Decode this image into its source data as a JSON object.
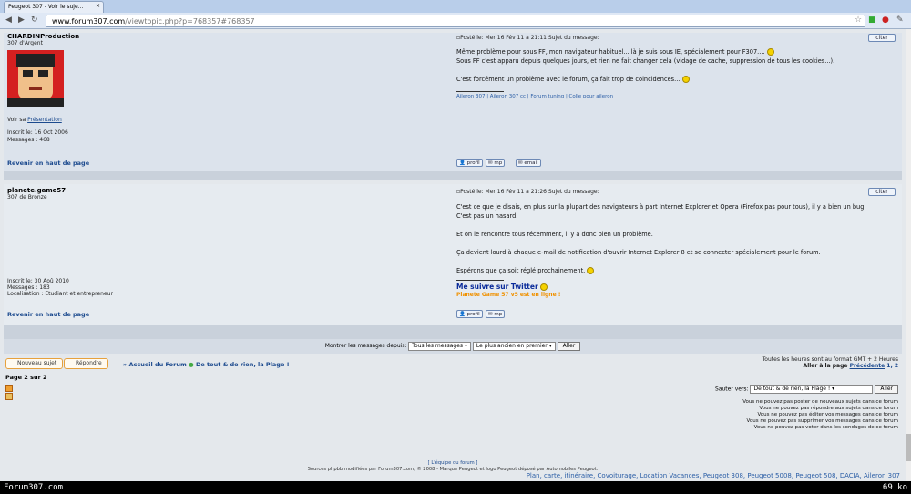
{
  "browser": {
    "tab_title": "Peugeot 307 - Voir le suje...",
    "url_domain": "www.forum307.com",
    "url_path": "/viewtopic.php?p=768357#768357"
  },
  "post1": {
    "username": "CHARDINProduction",
    "rank": "307 d'Argent",
    "see_label": "Voir sa",
    "presentation_link": "Présentation",
    "joined": "Inscrit le: 16 Oct 2006",
    "messages": "Messages : 468",
    "meta": "Posté le: Mer 16 Fév 11 à 21:11     Sujet du message:",
    "quote": "citer",
    "body": [
      "Même problème pour sous FF, mon navigateur habituel... là je suis sous IE, spécialement pour F307....",
      "Sous FF c'est apparu depuis quelques jours, et rien ne fait changer cela (vidage de cache, suppression de tous les cookies...).",
      "",
      "C'est forcément un problème avec le forum, ça fait trop de coincidences..."
    ],
    "signature": "Aileron 307 | Aileron 307 cc | Forum tuning | Colle pour aileron",
    "back_to_top": "Revenir en haut de page",
    "buttons": [
      "profil",
      "mp",
      "email"
    ]
  },
  "post2": {
    "username": "planete.game57",
    "rank": "307 de Bronze",
    "joined": "Inscrit le: 30 Aoû 2010",
    "messages": "Messages : 183",
    "location": "Localisation : Etudiant et entrepreneur",
    "meta": "Posté le: Mer 16 Fév 11 à 21:26     Sujet du message:",
    "quote": "citer",
    "body": [
      "C'est ce que je disais, en plus sur la plupart des navigateurs à part Internet Explorer et Opera (Firefox pas pour tous), il y a bien un bug.",
      "C'est pas un hasard.",
      "",
      "Et on le rencontre tous récemment, il y a donc bien un problème.",
      "",
      "Ça devient lourd à chaque e-mail de notification d'ouvrir Internet Explorer 8 et se connecter spécialement pour le forum.",
      "",
      "Espérons que ça soit réglé prochainement."
    ],
    "twitter": "Me suivre sur Twitter",
    "game_line": "Planete Game 57 v5 est en ligne !",
    "back_to_top": "Revenir en haut de page",
    "buttons": [
      "profil",
      "mp"
    ]
  },
  "show_bar": {
    "label": "Montrer les messages depuis:",
    "select1": "Tous les messages",
    "select2": "Le plus ancien en premier",
    "go": "Aller"
  },
  "actions": {
    "new_topic": "Nouveau sujet",
    "reply": "Répondre",
    "crumb_home": "» Accueil du Forum",
    "crumb_forum": "De tout & de rien, la Plage !"
  },
  "timezone": "Toutes les heures sont au format GMT + 2 Heures",
  "goto_page": "Aller à la page",
  "prev_link": "Précédente",
  "pages": "1, 2",
  "page_of": "Page 2 sur 2",
  "jump": {
    "label": "Sauter vers:",
    "select": "De tout & de rien, la Plage !",
    "go": "Aller"
  },
  "permissions": [
    "Vous ne pouvez pas poster de nouveaux sujets dans ce forum",
    "Vous ne pouvez pas répondre aux sujets dans ce forum",
    "Vous ne pouvez pas éditer vos messages dans ce forum",
    "Vous ne pouvez pas supprimer vos messages dans ce forum",
    "Vous ne pouvez pas voter dans les sondages de ce forum"
  ],
  "footer": {
    "top": "[ L'équipe du forum ]",
    "copyright": "Sources phpbb modifiées par Forum307.com, © 2008 - Marque Peugeot et logo Peugeot déposé par Automobiles Peugeot.",
    "links": "Plan, carte, itinéraire, Covoiturage, Location Vacances, Peugeot 308, Peugeot 5008, Peugeot 508, DACIA, Aileron 307"
  },
  "status": {
    "left": "Forum307.com",
    "right": "69 ko"
  }
}
